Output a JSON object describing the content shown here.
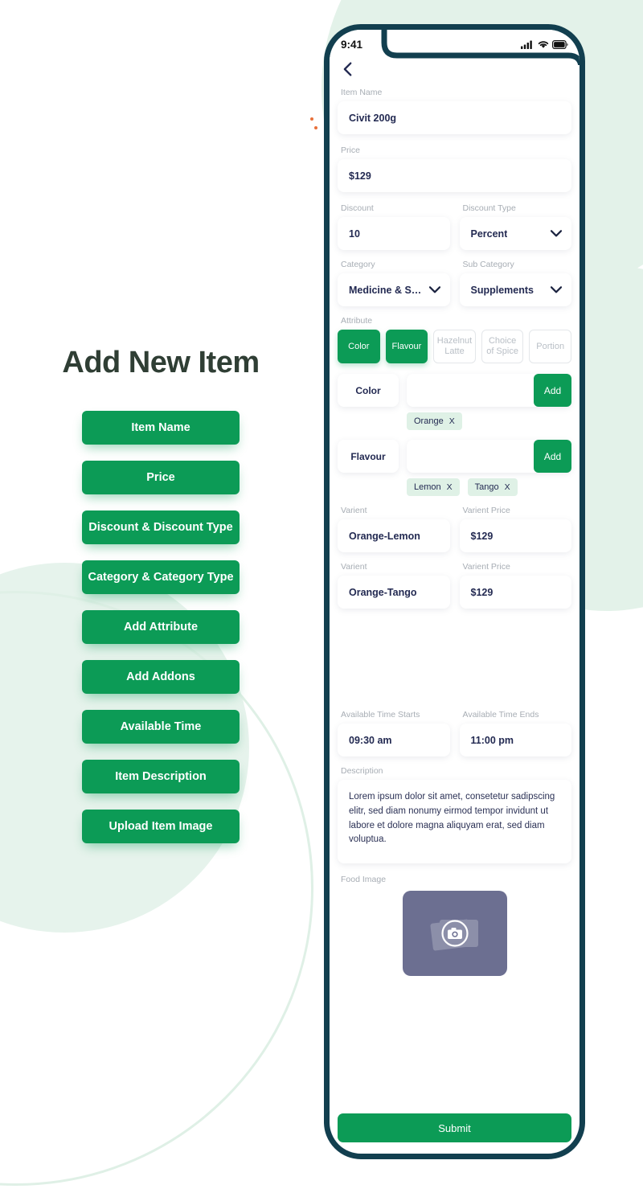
{
  "left": {
    "title": "Add New Item",
    "buttons": [
      "Item Name",
      "Price",
      "Discount & Discount Type",
      "Category & Category Type",
      "Add Attribute",
      "Add Addons",
      "Available Time",
      "Item Description",
      "Upload Item Image"
    ]
  },
  "statusbar": {
    "time": "9:41",
    "cellular_icon": "signal-bars-icon",
    "wifi_icon": "wifi-icon",
    "battery_icon": "battery-icon"
  },
  "nav": {
    "back_icon": "back-chevron-icon"
  },
  "form": {
    "item_name": {
      "label": "Item Name",
      "value": "Civit 200g"
    },
    "price": {
      "label": "Price",
      "value": "$129"
    },
    "discount": {
      "label": "Discount",
      "value": "10"
    },
    "discount_type": {
      "label": "Discount Type",
      "value": "Percent"
    },
    "category": {
      "label": "Category",
      "value": "Medicine & Supplim..."
    },
    "sub_category": {
      "label": "Sub Category",
      "value": "Supplements"
    },
    "attribute": {
      "label": "Attribute",
      "chips": [
        {
          "label": "Color",
          "selected": true
        },
        {
          "label": "Flavour",
          "selected": true
        },
        {
          "label": "Hazelnut Latte",
          "selected": false
        },
        {
          "label": "Choice of Spice",
          "selected": false
        },
        {
          "label": "Portion",
          "selected": false
        }
      ],
      "entries": [
        {
          "name": "Color",
          "input_value": "",
          "add_label": "Add",
          "tags": [
            {
              "label": "Orange",
              "remove": "X"
            }
          ]
        },
        {
          "name": "Flavour",
          "input_value": "",
          "add_label": "Add",
          "tags": [
            {
              "label": "Lemon",
              "remove": "X"
            },
            {
              "label": "Tango",
              "remove": "X"
            }
          ]
        }
      ]
    },
    "variants": [
      {
        "label": "Varient",
        "value": "Orange-Lemon",
        "price_label": "Varient Price",
        "price": "$129"
      },
      {
        "label": "Varient",
        "value": "Orange-Tango",
        "price_label": "Varient Price",
        "price": "$129"
      }
    ],
    "time_start": {
      "label": "Available Time Starts",
      "value": "09:30 am"
    },
    "time_end": {
      "label": "Available Time Ends",
      "value": "11:00 pm"
    },
    "description": {
      "label": "Description",
      "value": "Lorem ipsum dolor sit amet, consetetur sadipscing elitr, sed diam nonumy eirmod tempor invidunt ut labore et dolore magna aliquyam erat, sed diam voluptua."
    },
    "food_image": {
      "label": "Food Image",
      "icon": "camera-icon"
    },
    "submit": {
      "label": "Submit"
    }
  },
  "colors": {
    "brand_green": "#0c9b56",
    "frame_dark": "#123f4f",
    "text_navy": "#232a52",
    "label_gray": "#a7adb4",
    "tag_mint": "#dff1e6",
    "blob_green": "#e3f2e9",
    "image_placeholder": "#6c6f91",
    "accent_orange": "#e8703a"
  }
}
